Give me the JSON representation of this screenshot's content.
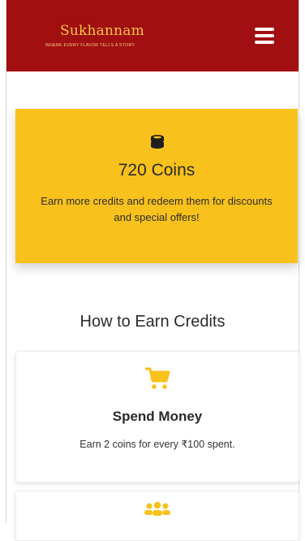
{
  "header": {
    "logo_text": "Sukhannam",
    "logo_tagline": "WHERE EVERY FLAVOR TELLS A STORY",
    "menu_icon": "hamburger-icon",
    "background": "#a10f10"
  },
  "coins": {
    "icon": "coins-icon",
    "title": "720 Coins",
    "description": "Earn more credits and redeem them for discounts and special offers!",
    "background": "#f8c11b"
  },
  "section": {
    "title": "How to Earn Credits"
  },
  "cards": [
    {
      "icon": "shopping-cart-icon",
      "title": "Spend Money",
      "description": "Earn 2 coins for every ₹100 spent."
    },
    {
      "icon": "users-icon"
    }
  ]
}
